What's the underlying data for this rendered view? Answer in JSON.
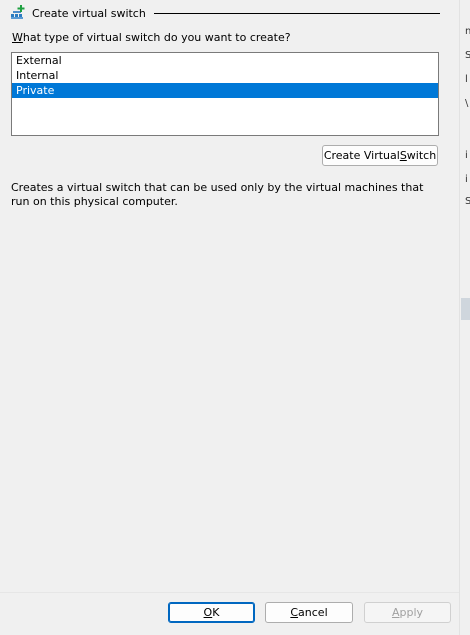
{
  "section": {
    "title": "Create virtual switch",
    "icon": "add-virtual-switch-icon"
  },
  "question": {
    "accel": "W",
    "rest": "hat type of virtual switch do you want to create?"
  },
  "switch_types": [
    {
      "label": "External",
      "selected": false
    },
    {
      "label": "Internal",
      "selected": false
    },
    {
      "label": "Private",
      "selected": true
    }
  ],
  "create_button": {
    "prefix": "Create Virtual ",
    "accel": "S",
    "suffix": "witch"
  },
  "description": "Creates a virtual switch that can be used only by the virtual machines that run on this physical computer.",
  "footer": {
    "ok": {
      "accel": "O",
      "rest": "K"
    },
    "cancel": {
      "accel": "C",
      "rest": "ancel"
    },
    "apply": {
      "accel": "A",
      "rest": "pply"
    }
  },
  "right_edge_fragments": [
    "n",
    "S",
    "l",
    "\\",
    "i",
    "i",
    "S"
  ],
  "colors": {
    "selection": "#0078d7",
    "background": "#f0f0f0",
    "primary_border": "#0067c0"
  }
}
